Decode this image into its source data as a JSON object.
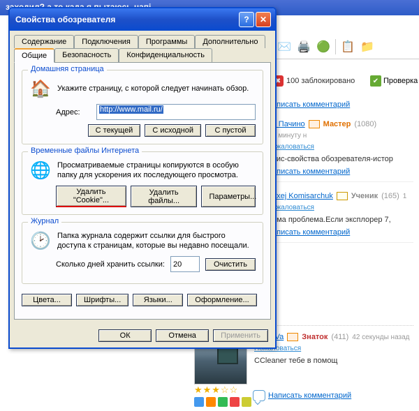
{
  "window": {
    "bg_title": "заходил? а то када я пытаюсь напі"
  },
  "dialog": {
    "title": "Свойства обозревателя",
    "tabs": {
      "content": "Содержание",
      "connections": "Подключения",
      "programs": "Программы",
      "advanced": "Дополнительно",
      "general": "Общие",
      "security": "Безопасность",
      "privacy": "Конфиденциальность"
    },
    "home": {
      "title": "Домашняя страница",
      "desc": "Укажите страницу, с которой следует начинать обзор.",
      "addr_label": "Адрес:",
      "addr_value": "http://www.mail.ru/",
      "btn_current": "С текущей",
      "btn_default": "С исходной",
      "btn_blank": "С пустой"
    },
    "temp": {
      "title": "Временные файлы Интернета",
      "desc": "Просматриваемые страницы копируются в особую папку для ускорения их последующего просмотра.",
      "btn_cookies": "Удалить \"Cookie\"...",
      "btn_files": "Удалить файлы...",
      "btn_params": "Параметры..."
    },
    "journal": {
      "title": "Журнал",
      "desc": "Папка журнала содержит ссылки для быстрого доступа к страницам, которые вы недавно посещали.",
      "days_label": "Сколько дней хранить ссылки:",
      "days_value": "20",
      "btn_clear": "Очистить"
    },
    "bottom": {
      "colors": "Цвета...",
      "fonts": "Шрифты...",
      "langs": "Языки...",
      "style": "Оформление..."
    },
    "actions": {
      "ok": "ОК",
      "cancel": "Отмена",
      "apply": "Применить"
    }
  },
  "toolbar": {
    "blocked": "100 заблокировано",
    "check": "Проверка"
  },
  "answers": [
    {
      "user": "ь Пачино",
      "rank_label": "Мастер",
      "rank_class": "rank-master",
      "points": "(1080)",
      "time": "1 минуту н",
      "complain": "ожаловаться",
      "body": "вис-свойства обозревателя-истор",
      "write": "аписать комментарий"
    },
    {
      "user": "exej Komisarchuk",
      "rank_label": "Ученик",
      "rank_class": "rank-uchenik",
      "points": "(165)",
      "time": "1",
      "complain": "ожаловаться",
      "body": "ома проблема.Если эксплорер 7,",
      "write": "аписать комментарий"
    }
  ],
  "write_top": "аписать комментарий",
  "answer_full": {
    "user": "LAVa",
    "rank_label": "Знаток",
    "rank_class": "rank-znatok",
    "points": "(411)",
    "time": "42 секунды назад",
    "complain": "Пожаловаться",
    "body": "CCleaner тебе в помощ",
    "write": "Написать комментарий",
    "stars": "★★★☆☆"
  }
}
